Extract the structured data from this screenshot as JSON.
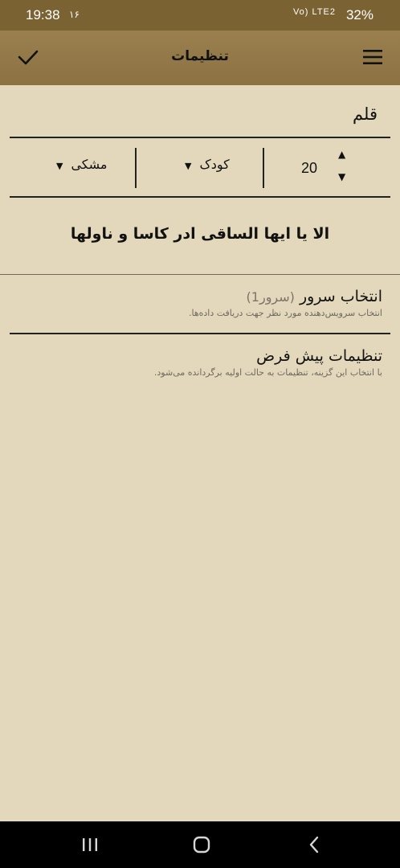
{
  "status": {
    "time": "19:38",
    "date": "۱۶",
    "signal": "Vo) LTE2",
    "battery": "32%"
  },
  "toolbar": {
    "title": "تنظیمات"
  },
  "font_section": {
    "title": "قلم",
    "size_value": "20",
    "font_name": "کودک",
    "font_color": "مشکی"
  },
  "preview": {
    "text": "الا یا ایها الساقی ادر کاسا و ناولها"
  },
  "server": {
    "title": "انتخاب سرور",
    "selected": "(سرور1)",
    "subtitle": "انتخاب سرویس‌دهنده مورد نظر جهت دریافت داده‌ها."
  },
  "defaults": {
    "title": "تنظیمات پیش فرض",
    "subtitle": "با انتخاب این گزینه، تنظیمات به حالت اولیه برگردانده می‌شود."
  }
}
